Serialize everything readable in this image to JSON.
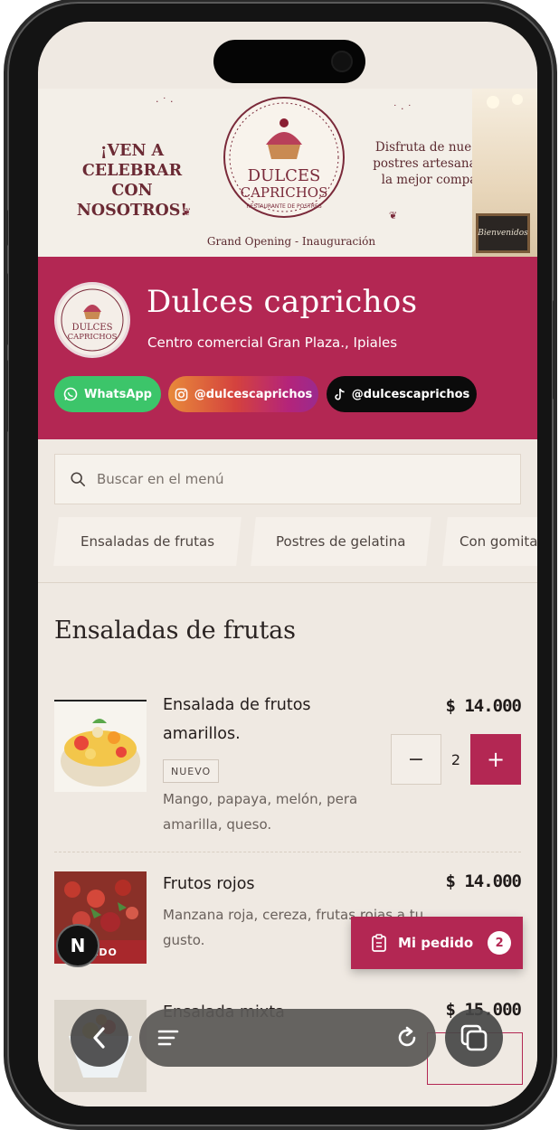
{
  "banner": {
    "headline_line1": "¡VEN A CELEBRAR",
    "headline_line2": "CON NOSOTROS!",
    "logo_line1": "DULCES",
    "logo_line2": "CAPRICHOS",
    "logo_subtitle": "RESTAURANTE DE POSTRES",
    "tagline_line1": "Disfruta de nuestros",
    "tagline_line2": "postres artesanales y",
    "tagline_line3": "la mejor compañía",
    "opening": "Grand Opening - Inauguración",
    "board_text": "Bienvenidos"
  },
  "store": {
    "name": "Dulces caprichos",
    "address": "Centro comercial Gran Plaza., Ipiales",
    "logo_line1": "DULCES",
    "logo_line2": "CAPRICHOS",
    "brand_color": "#b32753"
  },
  "social": {
    "whatsapp_label": "WhatsApp",
    "instagram_label": "@dulcescaprichos",
    "tiktok_label": "@dulcescaprichos"
  },
  "search": {
    "placeholder": "Buscar en el menú"
  },
  "categories": [
    "Ensaladas de frutas",
    "Postres de gelatina",
    "Con gomita"
  ],
  "section": {
    "title": "Ensaladas de frutas"
  },
  "items": [
    {
      "name_line1": "Ensalada de frutos",
      "name_line2": "amarillos.",
      "price": "$ 14.000",
      "badge": "NUEVO",
      "desc_line1": "Mango, papaya, melón, pera",
      "desc_line2": "amarilla, queso.",
      "quantity": "2",
      "minus": "−",
      "plus": "+"
    },
    {
      "name_line1": "Frutos rojos",
      "price": "$ 14.000",
      "desc_line1": "Manzana roja, cereza, frutas rojas a tu",
      "desc_line2": "gusto.",
      "status": "TADO"
    },
    {
      "name_line1": "Ensalada mixta",
      "price": "$ 15.000"
    }
  ],
  "order": {
    "label": "Mi pedido",
    "count": "2"
  },
  "overlay": {
    "n_badge": "N"
  },
  "icons": {
    "search": "search-icon",
    "whatsapp": "whatsapp-icon",
    "instagram": "instagram-icon",
    "tiktok": "tiktok-icon",
    "clipboard": "clipboard-icon",
    "back": "chevron-left-icon",
    "menu": "menu-icon",
    "reload": "reload-icon",
    "tabs": "tabs-icon"
  }
}
